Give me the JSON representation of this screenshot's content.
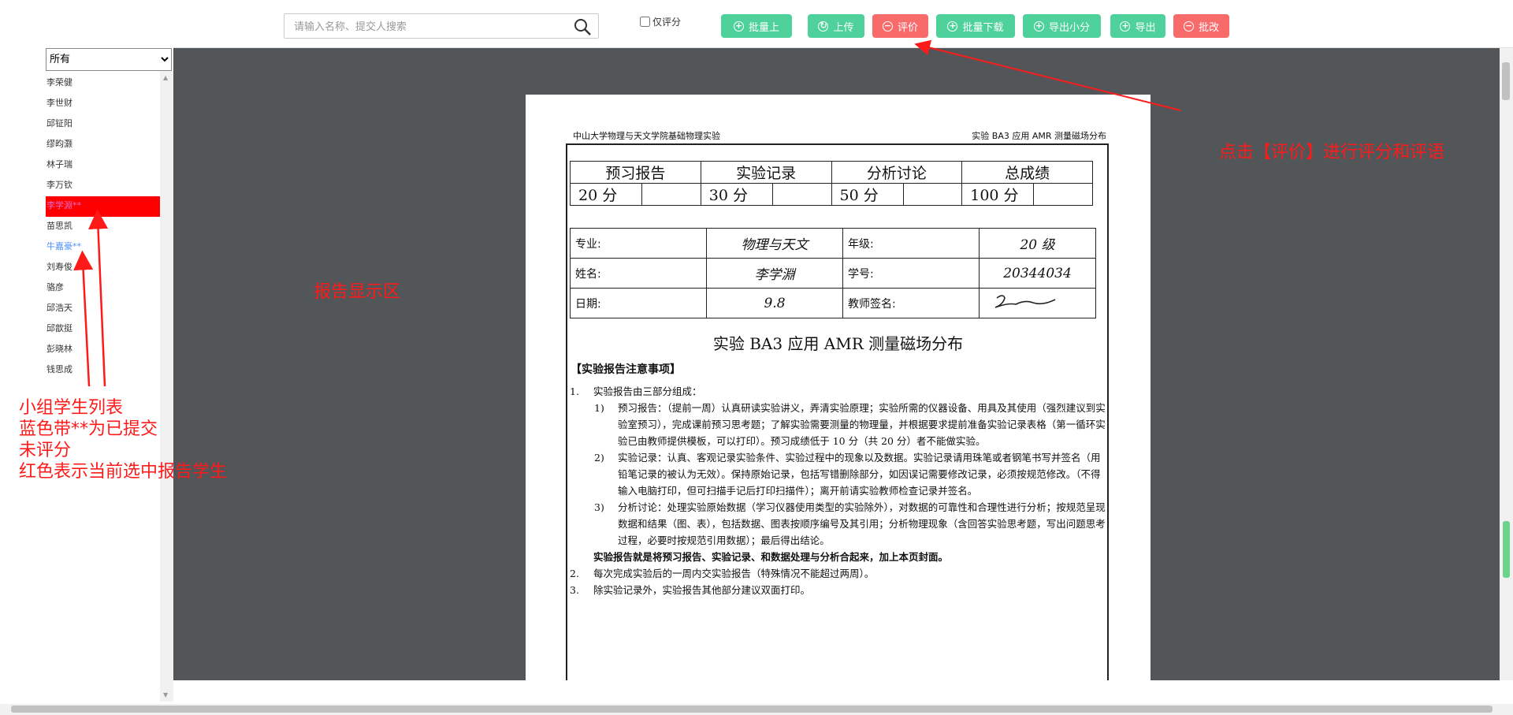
{
  "toolbar": {
    "search_placeholder": "请输入名称、提交人搜索",
    "only_score_label": "仅评分",
    "buttons": {
      "batch_upload": "批量上",
      "upload": "上传",
      "evaluate": "评价",
      "batch_download": "批量下载",
      "export_minor": "导出小分",
      "export": "导出",
      "approve": "批改"
    }
  },
  "sidebar": {
    "filter_selected": "所有",
    "students": [
      "李荣健",
      "李世财",
      "邱钲阳",
      "缪昀灏",
      "林子瑞",
      "李万钦",
      "李学淵**",
      "苗思凯",
      "牛嘉豪**",
      "刘寿俊",
      "骆彦",
      "邱浩天",
      "邱歆挺",
      "彭晓林",
      "钱思成"
    ],
    "selected_index": 6,
    "submitted_index": 8
  },
  "report": {
    "header_left": "中山大学物理与天文学院基础物理实验",
    "header_right": "实验 BA3 应用 AMR 测量磁场分布",
    "score_captions": [
      "预习报告",
      "实验记录",
      "分析讨论",
      "总成绩"
    ],
    "score_max": [
      "20 分",
      "30 分",
      "50 分",
      "100 分"
    ],
    "info": {
      "major_label": "专业:",
      "major_value": "物理与天文",
      "grade_label": "年级:",
      "grade_value": "20 级",
      "name_label": "姓名:",
      "name_value": "李学淵",
      "id_label": "学号:",
      "id_value": "20344034",
      "date_label": "日期:",
      "date_value": "9.8",
      "teacher_label": "教师签名:"
    },
    "title": "实验 BA3 应用 AMR 测量磁场分布",
    "notice_heading": "【实验报告注意事项】",
    "item1": "实验报告由三部分组成：",
    "sub1_n": "1)",
    "sub1": "预习报告：（提前一周）认真研读实验讲义，弄清实验原理；实验所需的仪器设备、用具及其使用（强烈建议到实验室预习），完成课前预习思考题；了解实验需要测量的物理量，并根据要求提前准备实验记录表格（第一循环实验已由教师提供模板，可以打印）。预习成绩低于 10 分（共 20 分）者不能做实验。",
    "sub2_n": "2)",
    "sub2": "实验记录：认真、客观记录实验条件、实验过程中的现象以及数据。实验记录请用珠笔或者钢笔书写并签名（用铅笔记录的被认为无效）。保持原始记录，包括写错删除部分，如因误记需要修改记录，必须按规范修改。（不得输入电脑打印，但可扫描手记后打印扫描件）；离开前请实验教师检查记录并签名。",
    "sub3_n": "3)",
    "sub3": "分析讨论：处理实验原始数据（学习仪器使用类型的实验除外），对数据的可靠性和合理性进行分析；按规范呈现数据和结果（图、表），包括数据、图表按顺序编号及其引用；分析物理现象（含回答实验思考题，写出问题思考过程，必要时按规范引用数据）；最后得出结论。",
    "emphasis": "实验报告就是将预习报告、实验记录、和数据处理与分析合起来，加上本页封面。",
    "item2_n": "2.",
    "item2": "每次完成实验后的一周内交实验报告（特殊情况不能超过两周）。",
    "item3_n": "3.",
    "item3": "除实验记录外，实验报告其他部分建议双面打印。",
    "item1_n": "1."
  },
  "annotations": {
    "evaluate_hint": "点击【评价】进行评分和评语",
    "report_area": "报告显示区",
    "list_line1": "小组学生列表",
    "list_line2": "蓝色带**为已提交",
    "list_line3": "未评分",
    "list_line4": "红色表示当前选中报告学生"
  },
  "colors": {
    "green_button": "#4ed19a",
    "red_button": "#f86b6b",
    "annotation": "#ff1a1a",
    "viewer_bg": "#525659"
  }
}
